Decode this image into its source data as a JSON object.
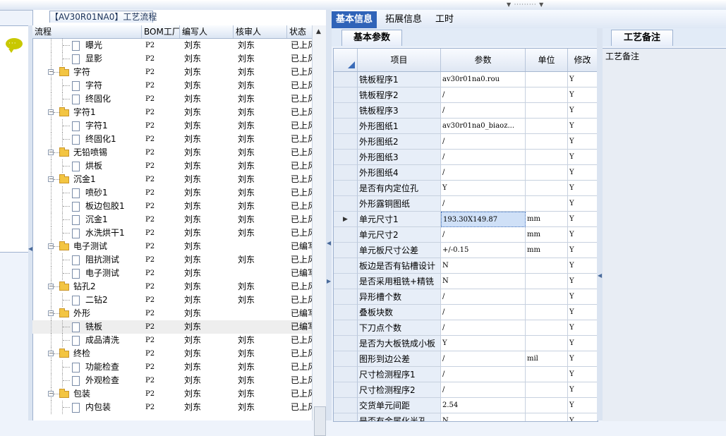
{
  "process_title": "【AV30R01NA0】工艺流程",
  "tree": {
    "headers": [
      "流程",
      "BOM工厂",
      "编写人",
      "核审人",
      "状态"
    ],
    "rows": [
      {
        "name": "曝光",
        "kind": "doc",
        "bom": "P2",
        "writer": "刘东",
        "reviewer": "刘东",
        "status": "已上风"
      },
      {
        "name": "显影",
        "kind": "doc",
        "bom": "P2",
        "writer": "刘东",
        "reviewer": "刘东",
        "status": "已上风"
      },
      {
        "name": "字符",
        "kind": "folder",
        "bom": "P2",
        "writer": "刘东",
        "reviewer": "刘东",
        "status": "已上风"
      },
      {
        "name": "字符",
        "kind": "doc",
        "bom": "P2",
        "writer": "刘东",
        "reviewer": "刘东",
        "status": "已上风"
      },
      {
        "name": "终固化",
        "kind": "doc",
        "bom": "P2",
        "writer": "刘东",
        "reviewer": "刘东",
        "status": "已上风"
      },
      {
        "name": "字符1",
        "kind": "folder",
        "bom": "P2",
        "writer": "刘东",
        "reviewer": "刘东",
        "status": "已上风"
      },
      {
        "name": "字符1",
        "kind": "doc",
        "bom": "P2",
        "writer": "刘东",
        "reviewer": "刘东",
        "status": "已上风"
      },
      {
        "name": "终固化1",
        "kind": "doc",
        "bom": "P2",
        "writer": "刘东",
        "reviewer": "刘东",
        "status": "已上风"
      },
      {
        "name": "无铅喷锡",
        "kind": "folder",
        "bom": "P2",
        "writer": "刘东",
        "reviewer": "刘东",
        "status": "已上风"
      },
      {
        "name": "烘板",
        "kind": "doc",
        "bom": "P2",
        "writer": "刘东",
        "reviewer": "刘东",
        "status": "已上风"
      },
      {
        "name": "沉金1",
        "kind": "folder",
        "bom": "P2",
        "writer": "刘东",
        "reviewer": "刘东",
        "status": "已上风"
      },
      {
        "name": "喷砂1",
        "kind": "doc",
        "bom": "P2",
        "writer": "刘东",
        "reviewer": "刘东",
        "status": "已上风"
      },
      {
        "name": "板边包胶1",
        "kind": "doc",
        "bom": "P2",
        "writer": "刘东",
        "reviewer": "刘东",
        "status": "已上风"
      },
      {
        "name": "沉金1",
        "kind": "doc",
        "bom": "P2",
        "writer": "刘东",
        "reviewer": "刘东",
        "status": "已上风"
      },
      {
        "name": "水洗烘干1",
        "kind": "doc",
        "bom": "P2",
        "writer": "刘东",
        "reviewer": "刘东",
        "status": "已上风"
      },
      {
        "name": "电子测试",
        "kind": "folder",
        "bom": "P2",
        "writer": "刘东",
        "reviewer": "",
        "status": "已编写"
      },
      {
        "name": "阻抗测试",
        "kind": "doc",
        "bom": "P2",
        "writer": "刘东",
        "reviewer": "刘东",
        "status": "已上风"
      },
      {
        "name": "电子测试",
        "kind": "doc",
        "bom": "P2",
        "writer": "刘东",
        "reviewer": "",
        "status": "已编写"
      },
      {
        "name": "钻孔2",
        "kind": "folder",
        "bom": "P2",
        "writer": "刘东",
        "reviewer": "刘东",
        "status": "已上风"
      },
      {
        "name": "二钻2",
        "kind": "doc",
        "bom": "P2",
        "writer": "刘东",
        "reviewer": "刘东",
        "status": "已上风"
      },
      {
        "name": "外形",
        "kind": "folder",
        "bom": "P2",
        "writer": "刘东",
        "reviewer": "",
        "status": "已编写"
      },
      {
        "name": "铣板",
        "kind": "doc",
        "bom": "P2",
        "writer": "刘东",
        "reviewer": "",
        "status": "已编写"
      },
      {
        "name": "成品清洗",
        "kind": "doc",
        "bom": "P2",
        "writer": "刘东",
        "reviewer": "刘东",
        "status": "已上风"
      },
      {
        "name": "终检",
        "kind": "folder",
        "bom": "P2",
        "writer": "刘东",
        "reviewer": "刘东",
        "status": "已上风"
      },
      {
        "name": "功能检查",
        "kind": "doc",
        "bom": "P2",
        "writer": "刘东",
        "reviewer": "刘东",
        "status": "已上风"
      },
      {
        "name": "外观检查",
        "kind": "doc",
        "bom": "P2",
        "writer": "刘东",
        "reviewer": "刘东",
        "status": "已上风"
      },
      {
        "name": "包装",
        "kind": "folder",
        "bom": "P2",
        "writer": "刘东",
        "reviewer": "刘东",
        "status": "已上风"
      },
      {
        "name": "内包装",
        "kind": "doc",
        "bom": "P2",
        "writer": "刘东",
        "reviewer": "刘东",
        "status": "已上风"
      }
    ]
  },
  "main_tabs": [
    "基本信息",
    "拓展信息",
    "工时"
  ],
  "sub_tab": "基本参数",
  "grid": {
    "headers": [
      "项目",
      "参数",
      "单位",
      "修改"
    ],
    "rows": [
      {
        "item": "铣板程序1",
        "param": "av30r01na0.rou",
        "unit": "",
        "mod": "Y"
      },
      {
        "item": "铣板程序2",
        "param": "/",
        "unit": "",
        "mod": "Y"
      },
      {
        "item": "铣板程序3",
        "param": "/",
        "unit": "",
        "mod": "Y"
      },
      {
        "item": "外形图纸1",
        "param": "av30r01na0_biaoz...",
        "unit": "",
        "mod": "Y"
      },
      {
        "item": "外形图纸2",
        "param": "/",
        "unit": "",
        "mod": "Y"
      },
      {
        "item": "外形图纸3",
        "param": "/",
        "unit": "",
        "mod": "Y"
      },
      {
        "item": "外形图纸4",
        "param": "/",
        "unit": "",
        "mod": "Y"
      },
      {
        "item": "是否有内定位孔",
        "param": "Y",
        "unit": "",
        "mod": "Y"
      },
      {
        "item": "外形露铜图纸",
        "param": "/",
        "unit": "",
        "mod": "Y"
      },
      {
        "item": "单元尺寸1",
        "param": "193.30X149.87",
        "unit": "mm",
        "mod": "Y"
      },
      {
        "item": "单元尺寸2",
        "param": "/",
        "unit": "mm",
        "mod": "Y"
      },
      {
        "item": "单元板尺寸公差",
        "param": "+/-0.15",
        "unit": "mm",
        "mod": "Y"
      },
      {
        "item": "板边是否有钻槽设计",
        "param": "N",
        "unit": "",
        "mod": "Y"
      },
      {
        "item": "是否采用粗铣+精铣",
        "param": "N",
        "unit": "",
        "mod": "Y"
      },
      {
        "item": "异形槽个数",
        "param": "/",
        "unit": "",
        "mod": "Y"
      },
      {
        "item": "叠板块数",
        "param": "/",
        "unit": "",
        "mod": "Y"
      },
      {
        "item": "下刀点个数",
        "param": "/",
        "unit": "",
        "mod": "Y"
      },
      {
        "item": "是否为大板铣成小板",
        "param": "Y",
        "unit": "",
        "mod": "Y"
      },
      {
        "item": "图形到边公差",
        "param": "/",
        "unit": "mil",
        "mod": "Y"
      },
      {
        "item": "尺寸检测程序1",
        "param": "/",
        "unit": "",
        "mod": "Y"
      },
      {
        "item": "尺寸检测程序2",
        "param": "/",
        "unit": "",
        "mod": "Y"
      },
      {
        "item": "交货单元间距",
        "param": "2.54",
        "unit": "",
        "mod": "Y"
      },
      {
        "item": "是否有金属化半孔",
        "param": "N",
        "unit": "",
        "mod": "Y"
      }
    ]
  },
  "notes_tab": "工艺备注",
  "notes_label": "工艺备注",
  "colors": {
    "active_tab": "#2f63b8",
    "folder": "#f3c542",
    "panel_bg": "#eef3fb"
  }
}
